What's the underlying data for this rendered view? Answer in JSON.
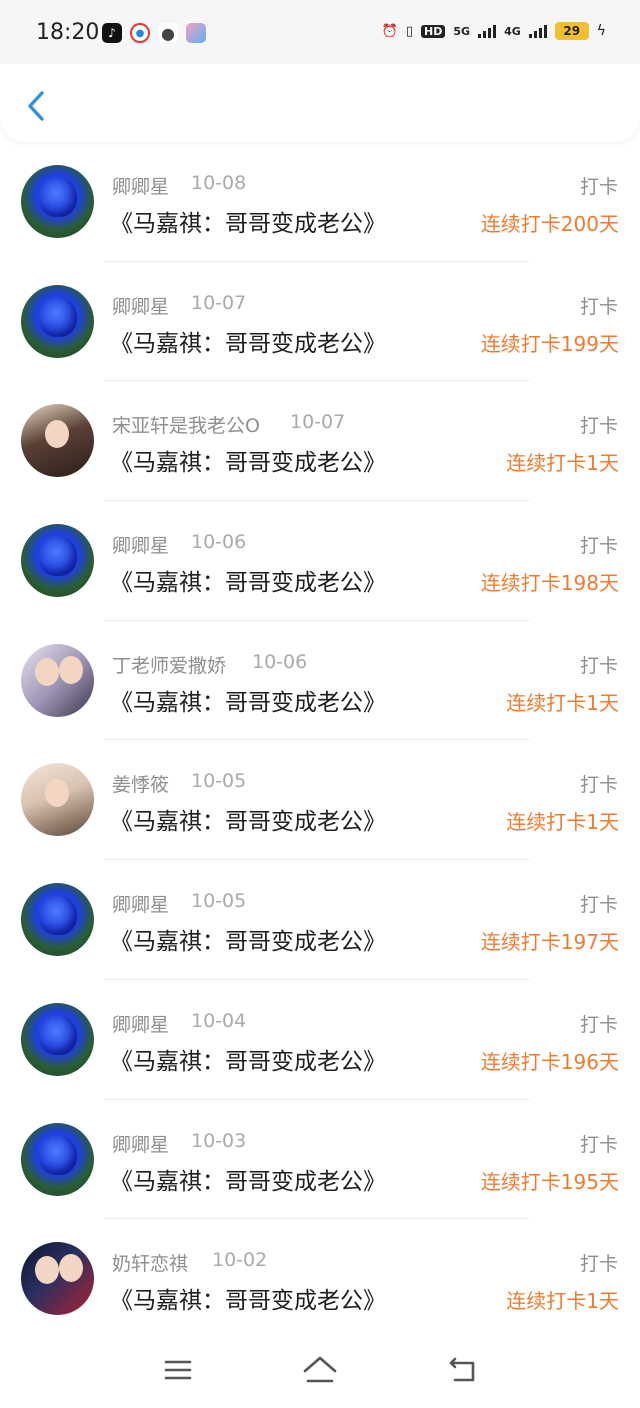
{
  "status": {
    "time": "18:20",
    "hd": "HD",
    "net5g": "5G",
    "net4g": "4G",
    "battery": "29"
  },
  "nav": {
    "back_icon": "chevron-left-icon"
  },
  "items": [
    {
      "name": "卿卿星",
      "date": "10-08",
      "title": "《马嘉祺：哥哥变成老公》",
      "kind": "打卡",
      "streak": "连续打卡200天",
      "avatar": "rose"
    },
    {
      "name": "卿卿星",
      "date": "10-07",
      "title": "《马嘉祺：哥哥变成老公》",
      "kind": "打卡",
      "streak": "连续打卡199天",
      "avatar": "rose"
    },
    {
      "name": "宋亚轩是我老公O",
      "date": "10-07",
      "title": "《马嘉祺：哥哥变成老公》",
      "kind": "打卡",
      "streak": "连续打卡1天",
      "avatar": "boy"
    },
    {
      "name": "卿卿星",
      "date": "10-06",
      "title": "《马嘉祺：哥哥变成老公》",
      "kind": "打卡",
      "streak": "连续打卡198天",
      "avatar": "rose"
    },
    {
      "name": "丁老师爱撒娇",
      "date": "10-06",
      "title": "《马嘉祺：哥哥变成老公》",
      "kind": "打卡",
      "streak": "连续打卡1天",
      "avatar": "duo"
    },
    {
      "name": "姜悸筱",
      "date": "10-05",
      "title": "《马嘉祺：哥哥变成老公》",
      "kind": "打卡",
      "streak": "连续打卡1天",
      "avatar": "girl"
    },
    {
      "name": "卿卿星",
      "date": "10-05",
      "title": "《马嘉祺：哥哥变成老公》",
      "kind": "打卡",
      "streak": "连续打卡197天",
      "avatar": "rose"
    },
    {
      "name": "卿卿星",
      "date": "10-04",
      "title": "《马嘉祺：哥哥变成老公》",
      "kind": "打卡",
      "streak": "连续打卡196天",
      "avatar": "rose"
    },
    {
      "name": "卿卿星",
      "date": "10-03",
      "title": "《马嘉祺：哥哥变成老公》",
      "kind": "打卡",
      "streak": "连续打卡195天",
      "avatar": "rose"
    },
    {
      "name": "奶轩恋祺",
      "date": "10-02",
      "title": "《马嘉祺：哥哥变成老公》",
      "kind": "打卡",
      "streak": "连续打卡1天",
      "avatar": "stage"
    }
  ],
  "bottom_nav": {
    "menu_icon": "menu-icon",
    "home_icon": "home-icon",
    "back_icon": "return-icon"
  },
  "colors": {
    "accent": "#2f8fe6",
    "streak": "#ef7b2f"
  }
}
